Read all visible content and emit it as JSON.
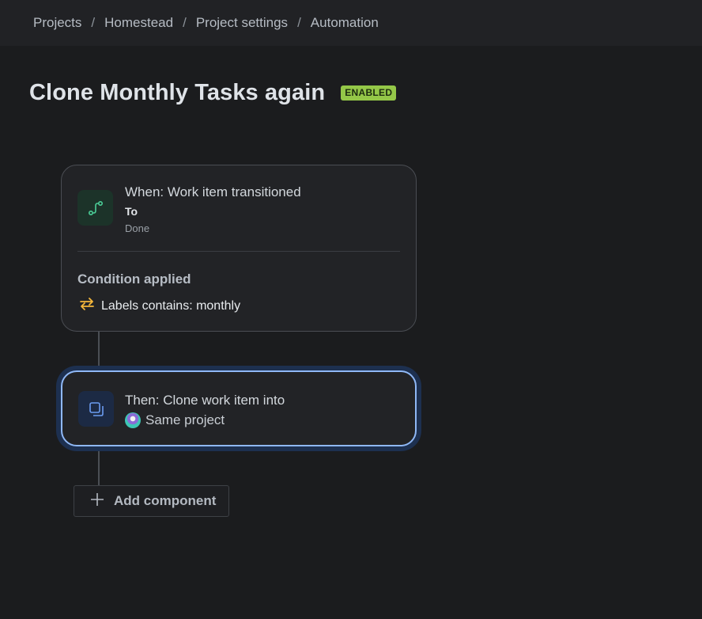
{
  "breadcrumb": {
    "items": [
      "Projects",
      "Homestead",
      "Project settings",
      "Automation"
    ],
    "separator": "/"
  },
  "rule": {
    "title": "Clone Monthly Tasks again",
    "status": "ENABLED"
  },
  "trigger": {
    "title": "When: Work item transitioned",
    "field_label": "To",
    "field_value": "Done",
    "icon": "transition-icon"
  },
  "condition": {
    "heading": "Condition applied",
    "text": "Labels contains: monthly",
    "icon": "swap-arrows-icon"
  },
  "action": {
    "title": "Then: Clone work item into",
    "target": "Same project",
    "icon": "clone-icon"
  },
  "add_component": {
    "label": "Add component"
  },
  "colors": {
    "background": "#1b1c1e",
    "badge": "#94c748",
    "selected_border": "#8fb8f6",
    "condition_icon": "#f5b73b"
  }
}
